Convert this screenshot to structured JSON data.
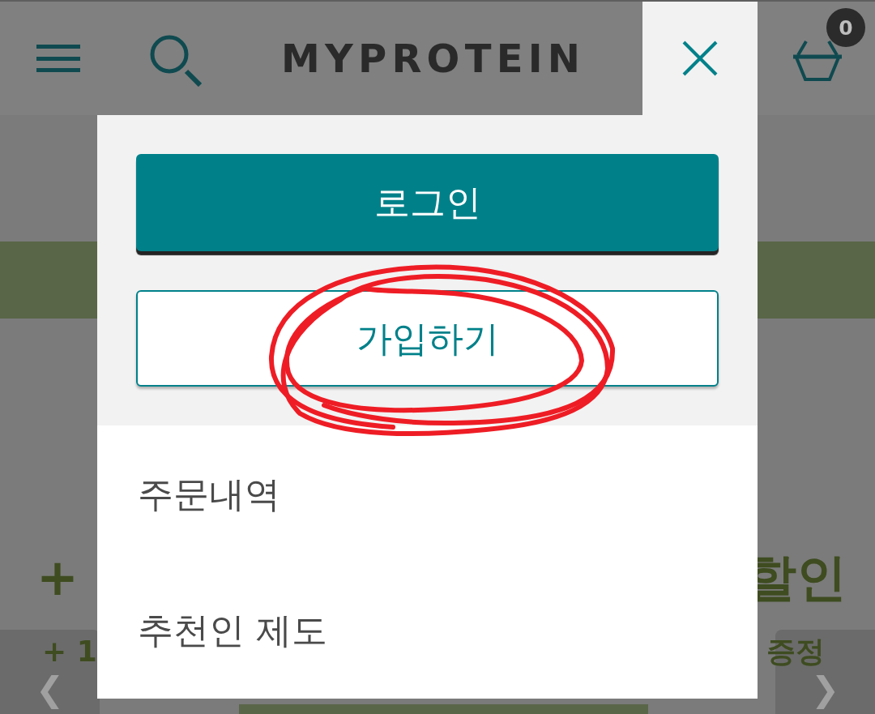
{
  "header": {
    "logo": "MYPROTEIN",
    "cart_count": "0"
  },
  "account_menu": {
    "buttons": [
      {
        "label": "로그인",
        "kind": "primary"
      },
      {
        "label": "가입하기",
        "kind": "outline"
      }
    ],
    "links": [
      "주문내역",
      "추천인 제도"
    ]
  },
  "page_behind": {
    "promo_lines": [
      {
        "left": "+",
        "right": "할인",
        "kind": "headline"
      },
      {
        "left": "+ 1",
        "right": "증정",
        "kind": "subline"
      }
    ],
    "carousel": {
      "previous": "❮",
      "next": "❯"
    }
  }
}
